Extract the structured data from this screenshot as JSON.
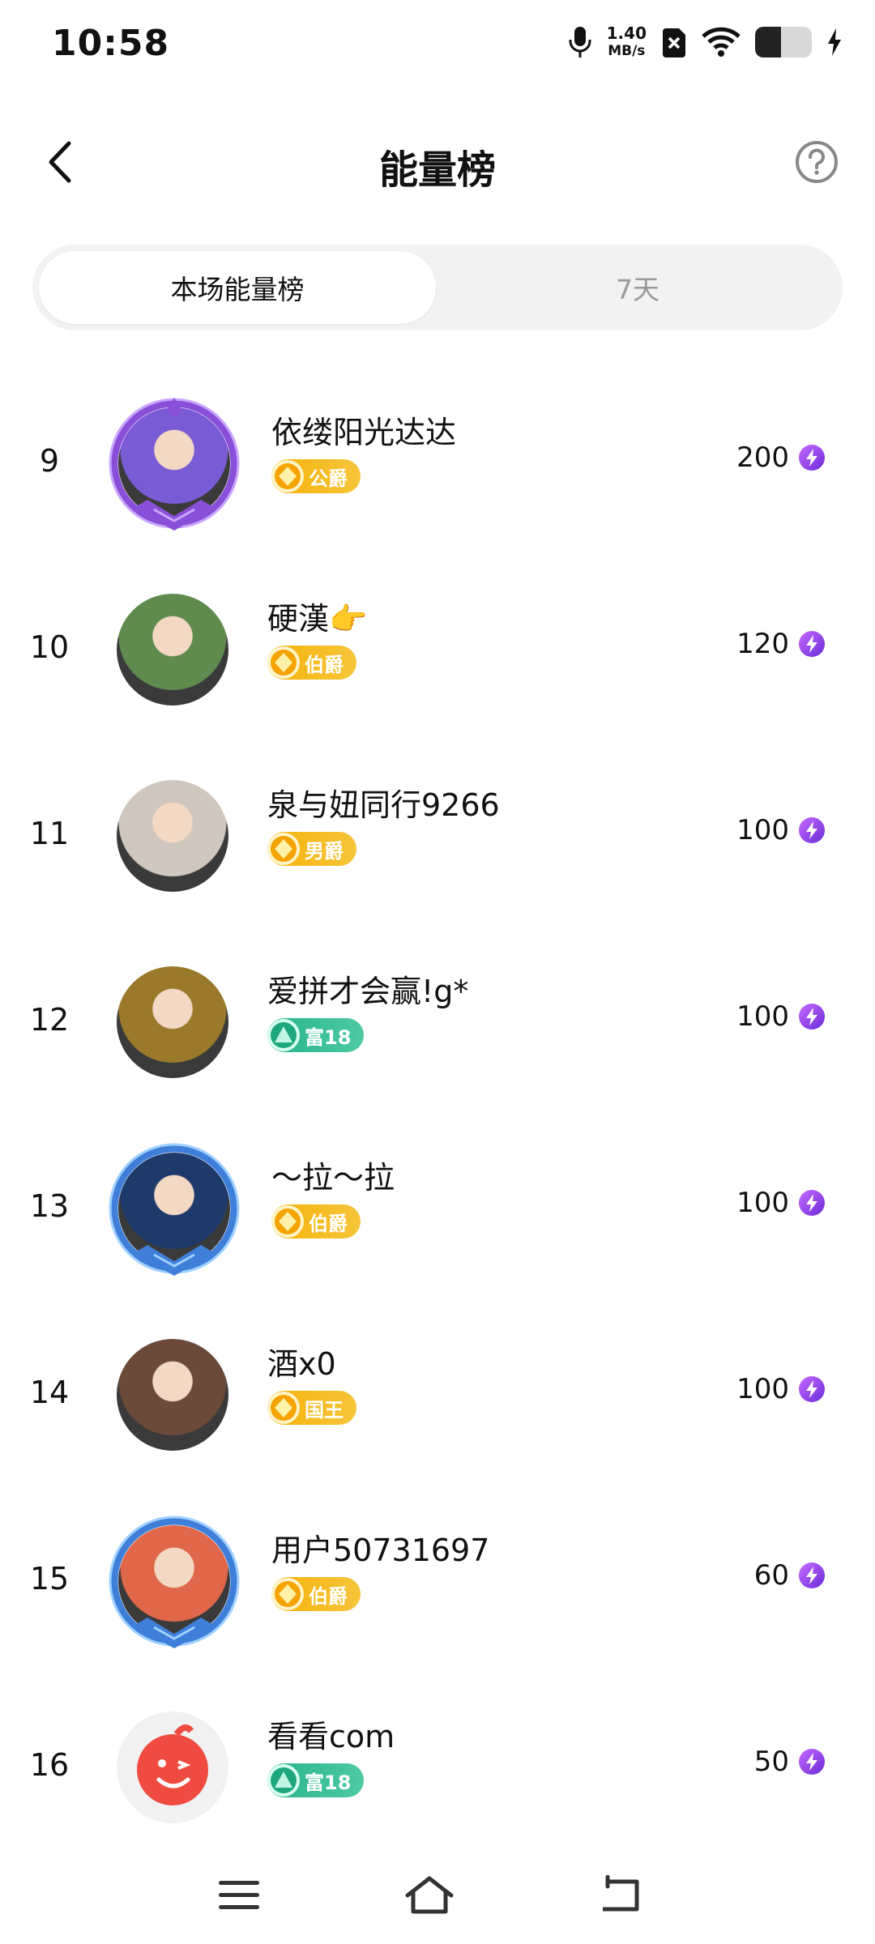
{
  "status_bar": {
    "time": "10:58",
    "net_speed": "1.40",
    "net_unit": "MB/s",
    "battery_level": 0.45,
    "icons": [
      "mic-icon",
      "sim-card-x-icon",
      "wifi-icon",
      "battery-icon",
      "charging-bolt-icon"
    ]
  },
  "header": {
    "title": "能量榜",
    "back_icon": "chevron-left-icon",
    "help_icon": "question-circle-icon"
  },
  "tabs": [
    {
      "label": "本场能量榜",
      "active": true
    },
    {
      "label": "7天",
      "active": false
    }
  ],
  "rows": [
    {
      "rank": "9",
      "name": "依缕阳光达达",
      "badge": "公爵",
      "badge_type": "gold",
      "score": "200",
      "avatar_color": "#7a5bd6",
      "frame": "purple-crest"
    },
    {
      "rank": "10",
      "name": "硬漢👉",
      "badge": "伯爵",
      "badge_type": "gold",
      "score": "120",
      "avatar_color": "#5f8b4f",
      "frame": "none"
    },
    {
      "rank": "11",
      "name": "泉与妞同行9266",
      "badge": "男爵",
      "badge_type": "gold",
      "score": "100",
      "avatar_color": "#cfc7bd",
      "frame": "none"
    },
    {
      "rank": "12",
      "name": "爱拼才会赢!g*",
      "badge": "富18",
      "badge_type": "green",
      "score": "100",
      "avatar_color": "#9a7a2a",
      "frame": "none"
    },
    {
      "rank": "13",
      "name": "～拉～拉",
      "badge": "伯爵",
      "badge_type": "gold",
      "score": "100",
      "avatar_color": "#1e3a6b",
      "frame": "blue-crest"
    },
    {
      "rank": "14",
      "name": "酒x0",
      "badge": "国王",
      "badge_type": "gold",
      "score": "100",
      "avatar_color": "#6b4a3a",
      "frame": "none"
    },
    {
      "rank": "15",
      "name": "用户50731697",
      "badge": "伯爵",
      "badge_type": "gold",
      "score": "60",
      "avatar_color": "#e0674a",
      "frame": "blue-crest"
    },
    {
      "rank": "16",
      "name": "看看com",
      "badge": "富18",
      "badge_type": "green",
      "score": "50",
      "avatar_color": "#ef4b40",
      "frame": "none"
    }
  ],
  "score_icon": "lightning-energy-icon",
  "nav_bar": {
    "icons": [
      "menu-icon",
      "home-icon",
      "back-nav-icon"
    ]
  }
}
